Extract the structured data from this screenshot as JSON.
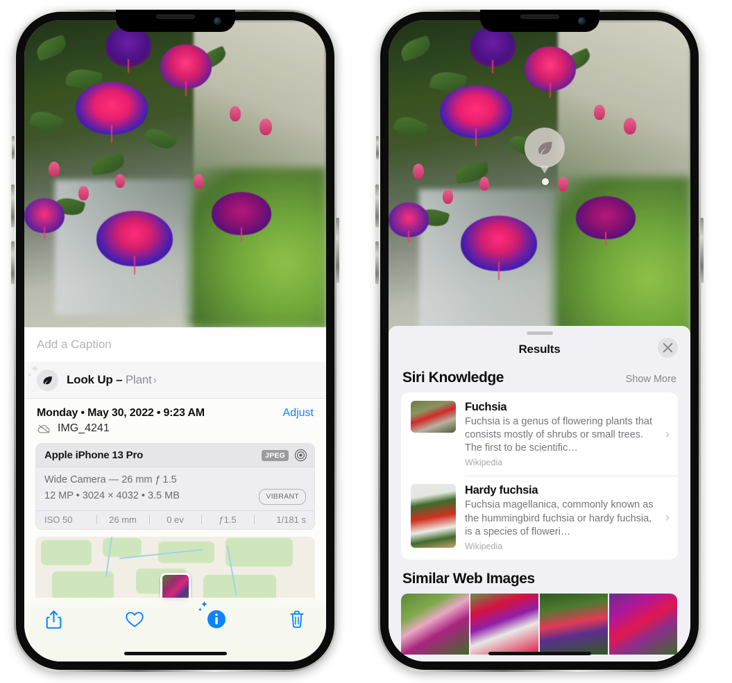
{
  "left_phone": {
    "photo_alt": "fuchsia-flowers-photo",
    "caption_placeholder": "Add a Caption",
    "lookup": {
      "icon": "leaf-icon",
      "label": "Look Up – ",
      "subject": "Plant",
      "chevron": "›"
    },
    "date": "Monday • May 30, 2022 • 9:23 AM",
    "adjust_label": "Adjust",
    "file_name": "IMG_4241",
    "cloud_icon": "cloud-slash-icon",
    "exif": {
      "device": "Apple iPhone 13 Pro",
      "format_badge": "JPEG",
      "raw_icon": "aperture-icon",
      "lens_line": "Wide Camera — 26 mm ƒ 1.5",
      "size_line": "12 MP • 3024 × 4032 • 3.5 MB",
      "style_badge": "VIBRANT",
      "stats": [
        "ISO 50",
        "26 mm",
        "0 ev",
        "ƒ1.5",
        "1/181 s"
      ]
    },
    "map": {
      "pin_label": "photo-location-pin"
    },
    "toolbar": [
      {
        "name": "share-icon",
        "label": "Share"
      },
      {
        "name": "heart-icon",
        "label": "Favorite"
      },
      {
        "name": "info-sparkle-icon",
        "label": "Info"
      },
      {
        "name": "trash-icon",
        "label": "Delete"
      }
    ],
    "accent_color": "#0a84ff"
  },
  "right_phone": {
    "visual_lookup_badge": "leaf-icon",
    "sheet": {
      "title": "Results",
      "close_icon": "close-icon",
      "sections": [
        {
          "title": "Siri Knowledge",
          "action": "Show More",
          "items": [
            {
              "title": "Fuchsia",
              "description": "Fuchsia is a genus of flowering plants that consists mostly of shrubs or small trees. The first to be scientific…",
              "source": "Wikipedia",
              "thumb": "fuchsia-thumbnail",
              "chevron": "›"
            },
            {
              "title": "Hardy fuchsia",
              "description": "Fuchsia magellanica, commonly known as the hummingbird fuchsia or hardy fuchsia, is a species of floweri…",
              "source": "Wikipedia",
              "thumb": "hardy-fuchsia-thumbnail",
              "chevron": "›"
            }
          ]
        },
        {
          "title": "Similar Web Images",
          "images": [
            "web-image-1",
            "web-image-2",
            "web-image-3",
            "web-image-4"
          ]
        }
      ]
    }
  }
}
